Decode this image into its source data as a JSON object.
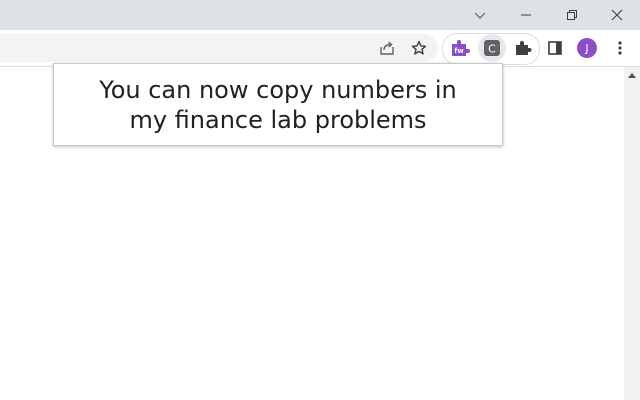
{
  "window": {
    "controls": {
      "tab_search_icon": "chevron-down-icon",
      "minimize_icon": "minimize-icon",
      "restore_icon": "restore-icon",
      "close_icon": "close-icon"
    }
  },
  "toolbar": {
    "share_icon": "share-icon",
    "bookmark_icon": "star-icon",
    "extensions": [
      {
        "name": "fw-extension",
        "icon": "puzzle-fw-icon",
        "color": "#8a4fc8",
        "label": "fw"
      },
      {
        "name": "c-extension",
        "icon": "c-icon",
        "color": "#5f6368",
        "label": "C"
      }
    ],
    "extensions_menu_icon": "puzzle-icon",
    "side_panel_icon": "side-panel-icon",
    "profile": {
      "initial": "J",
      "color": "#8a4fc8"
    },
    "menu_icon": "kebab-menu-icon"
  },
  "popup": {
    "message": "You can now copy numbers in my finance lab problems"
  },
  "colors": {
    "titlebar": "#dee1e6",
    "omnibox": "#f1f3f4",
    "accent_purple": "#8a4fc8"
  }
}
